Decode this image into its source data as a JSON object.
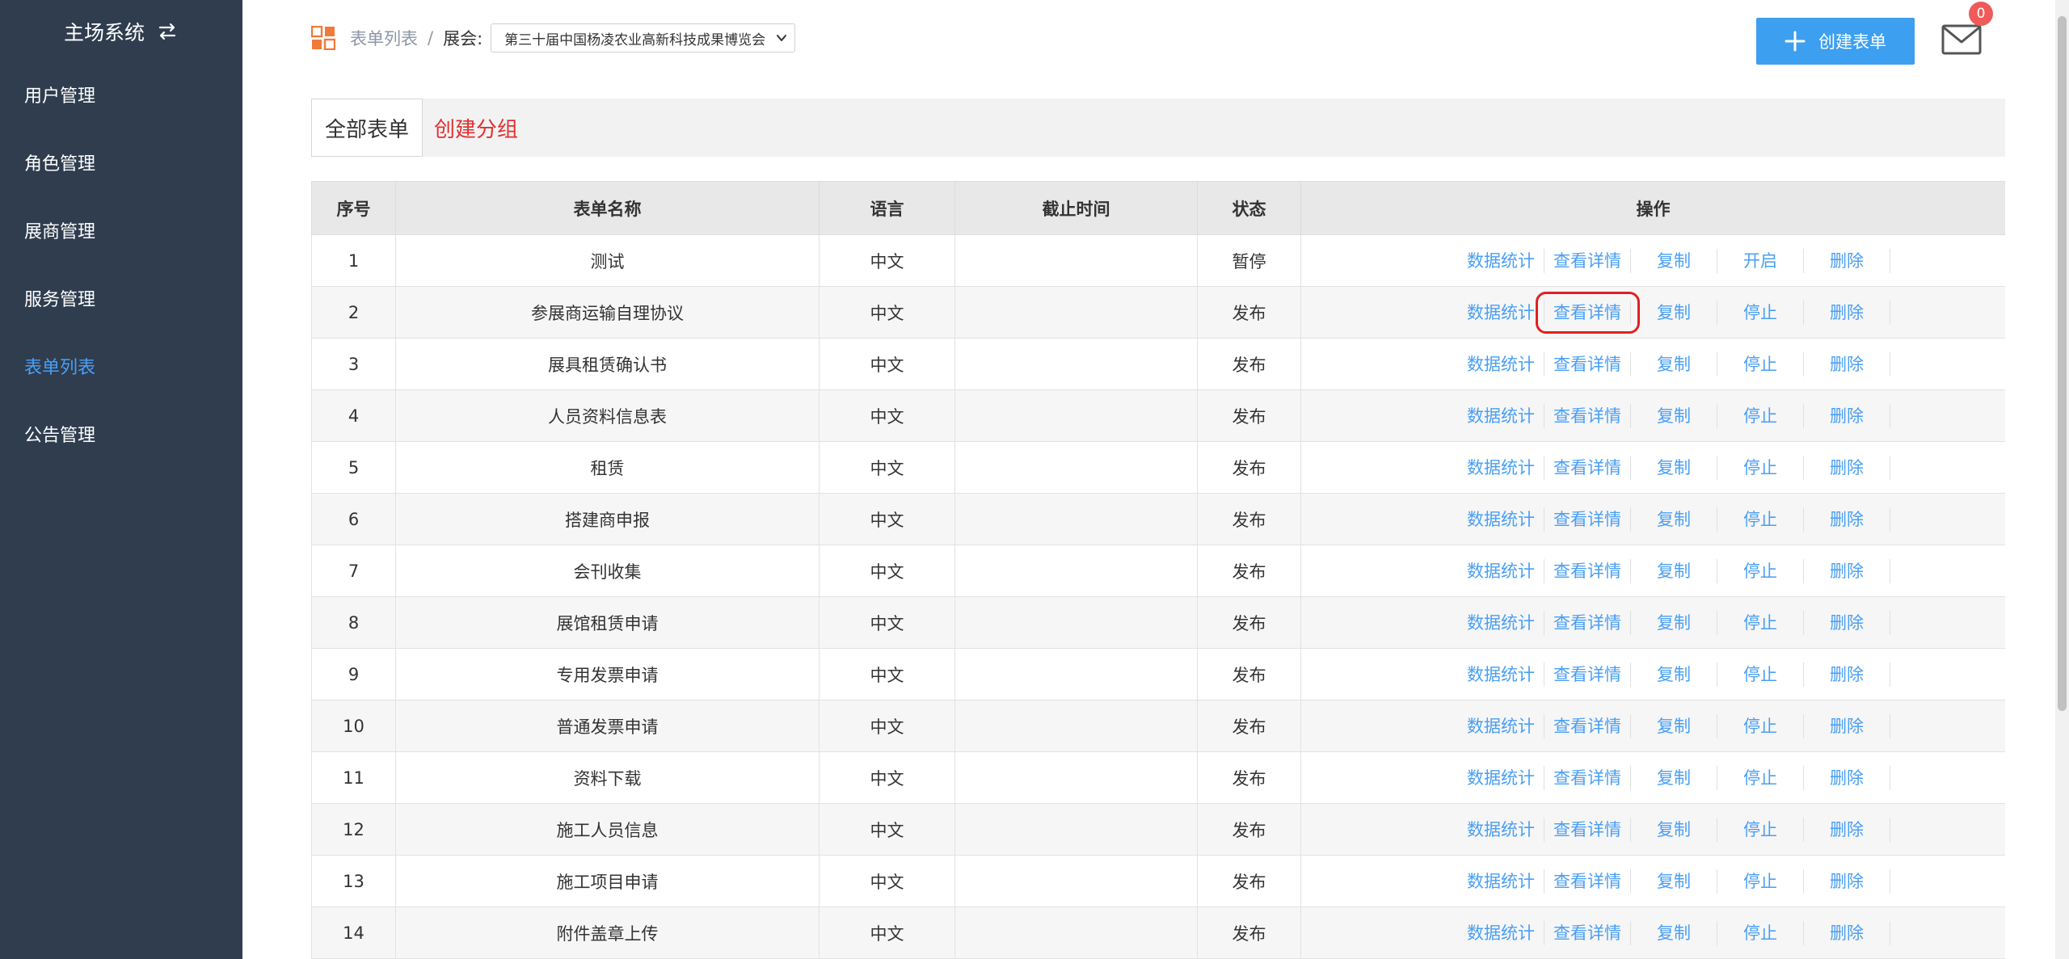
{
  "sidebar": {
    "title": "主场系统",
    "items": [
      {
        "label": "用户管理",
        "active": false
      },
      {
        "label": "角色管理",
        "active": false
      },
      {
        "label": "展商管理",
        "active": false
      },
      {
        "label": "服务管理",
        "active": false
      },
      {
        "label": "表单列表",
        "active": true
      },
      {
        "label": "公告管理",
        "active": false
      }
    ]
  },
  "header": {
    "breadcrumb_link": "表单列表",
    "separator": "/",
    "expo_label": "展会:",
    "expo_selected": "第三十届中国杨凌农业高新科技成果博览会",
    "create_button": "创建表单",
    "notification_count": "0"
  },
  "tabs": {
    "all": "全部表单",
    "create_group": "创建分组"
  },
  "table": {
    "headers": [
      "序号",
      "表单名称",
      "语言",
      "截止时间",
      "状态",
      "操作"
    ],
    "op_labels": {
      "stats": "数据统计",
      "detail": "查看详情",
      "copy": "复制",
      "remove": "删除"
    },
    "rows": [
      {
        "no": "1",
        "name": "测试",
        "lang": "中文",
        "deadline": "",
        "status": "暂停",
        "toggle": "开启"
      },
      {
        "no": "2",
        "name": "参展商运输自理协议",
        "lang": "中文",
        "deadline": "",
        "status": "发布",
        "toggle": "停止"
      },
      {
        "no": "3",
        "name": "展具租赁确认书",
        "lang": "中文",
        "deadline": "",
        "status": "发布",
        "toggle": "停止"
      },
      {
        "no": "4",
        "name": "人员资料信息表",
        "lang": "中文",
        "deadline": "",
        "status": "发布",
        "toggle": "停止"
      },
      {
        "no": "5",
        "name": "租赁",
        "lang": "中文",
        "deadline": "",
        "status": "发布",
        "toggle": "停止"
      },
      {
        "no": "6",
        "name": "搭建商申报",
        "lang": "中文",
        "deadline": "",
        "status": "发布",
        "toggle": "停止"
      },
      {
        "no": "7",
        "name": "会刊收集",
        "lang": "中文",
        "deadline": "",
        "status": "发布",
        "toggle": "停止"
      },
      {
        "no": "8",
        "name": "展馆租赁申请",
        "lang": "中文",
        "deadline": "",
        "status": "发布",
        "toggle": "停止"
      },
      {
        "no": "9",
        "name": "专用发票申请",
        "lang": "中文",
        "deadline": "",
        "status": "发布",
        "toggle": "停止"
      },
      {
        "no": "10",
        "name": "普通发票申请",
        "lang": "中文",
        "deadline": "",
        "status": "发布",
        "toggle": "停止"
      },
      {
        "no": "11",
        "name": "资料下载",
        "lang": "中文",
        "deadline": "",
        "status": "发布",
        "toggle": "停止"
      },
      {
        "no": "12",
        "name": "施工人员信息",
        "lang": "中文",
        "deadline": "",
        "status": "发布",
        "toggle": "停止"
      },
      {
        "no": "13",
        "name": "施工项目申请",
        "lang": "中文",
        "deadline": "",
        "status": "发布",
        "toggle": "停止"
      },
      {
        "no": "14",
        "name": "附件盖章上传",
        "lang": "中文",
        "deadline": "",
        "status": "发布",
        "toggle": "停止"
      }
    ]
  }
}
